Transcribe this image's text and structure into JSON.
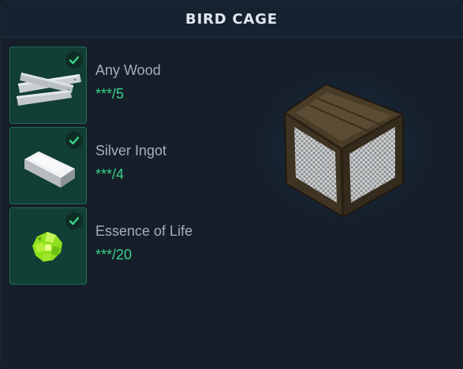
{
  "window": {
    "title": "BIRD CAGE"
  },
  "requirements": [
    {
      "name": "Any Wood",
      "count": "***/5",
      "icon": "wood-planks-icon",
      "complete": true
    },
    {
      "name": "Silver Ingot",
      "count": "***/4",
      "icon": "silver-ingot-icon",
      "complete": true
    },
    {
      "name": "Essence of Life",
      "count": "***/20",
      "icon": "essence-of-life-icon",
      "complete": true
    }
  ],
  "preview": {
    "icon": "bird-cage-icon"
  },
  "colors": {
    "accent": "#3ad28b",
    "slot_bg": "#123f35",
    "slot_border": "#1f6d57",
    "panel_bg": "#151e29"
  }
}
